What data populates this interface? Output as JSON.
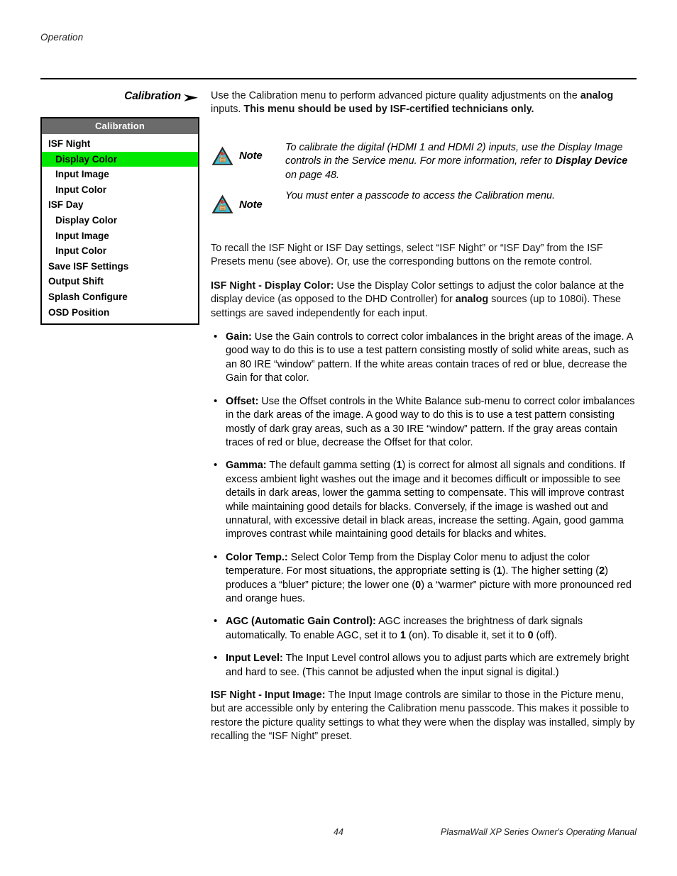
{
  "page": {
    "running_head": "Operation",
    "footer_page_number": "44",
    "footer_title": "PlasmaWall XP Series Owner's Operating Manual"
  },
  "margin_callout": {
    "label": "Calibration",
    "arrow_icon": "right-arrow-icon"
  },
  "osd_menu": {
    "title": "Calibration",
    "selected_item": "Display Color",
    "highlight_color": "#00e800",
    "title_bar_color": "#6b6b6b",
    "items": [
      {
        "label": "ISF Night",
        "level": 0,
        "selected": false
      },
      {
        "label": "Display Color",
        "level": 1,
        "selected": true
      },
      {
        "label": "Input Image",
        "level": 1,
        "selected": false
      },
      {
        "label": "Input Color",
        "level": 1,
        "selected": false
      },
      {
        "label": "ISF Day",
        "level": 0,
        "selected": false
      },
      {
        "label": "Display Color",
        "level": 1,
        "selected": false
      },
      {
        "label": "Input Image",
        "level": 1,
        "selected": false
      },
      {
        "label": "Input Color",
        "level": 1,
        "selected": false
      },
      {
        "label": "Save ISF Settings",
        "level": 0,
        "selected": false
      },
      {
        "label": "Output Shift",
        "level": 0,
        "selected": false
      },
      {
        "label": "Splash Configure",
        "level": 0,
        "selected": false
      },
      {
        "label": "OSD Position",
        "level": 0,
        "selected": false
      }
    ]
  },
  "intro": {
    "lead_plain_1": "Use the Calibration menu to perform advanced picture quality adjustments on the ",
    "lead_bold_1": "analog",
    "lead_plain_2": " inputs. ",
    "lead_bold_2": "This menu should be used by ISF-certified technicians only."
  },
  "notes": [
    {
      "label": "Note",
      "icon": "note-hand-triangle-icon",
      "text_1": "To calibrate the digital (HDMI 1 and HDMI 2) inputs, use the Display Image controls in the Service menu. For more information, refer to ",
      "text_bold": "Display Device",
      "text_2": " on page 48."
    },
    {
      "label": "Note",
      "icon": "note-hand-triangle-icon",
      "text_1": "You must enter a passcode to access the Calibration menu.",
      "text_bold": "",
      "text_2": ""
    }
  ],
  "paragraphs": {
    "recall": "To recall the ISF Night or ISF Day settings, select “ISF Night” or “ISF Day” from the ISF Presets menu (see above). Or, use the corresponding buttons on the remote control.",
    "display_color_heading": "ISF Night - Display Color:",
    "display_color_1": " Use the Display Color settings to adjust the color balance at the display device (as opposed to the DHD Controller) for ",
    "display_color_bold": "analog",
    "display_color_2": " sources (up to 1080i). These settings are saved independently for each input.",
    "input_image_heading": "ISF Night - Input Image:",
    "input_image_body": " The Input Image controls are similar to those in the Picture menu, but are accessible only by entering the Calibration menu passcode. This makes it possible to restore the picture quality settings to what they were when the display was installed, simply by recalling the “ISF Night” preset."
  },
  "bullets": [
    {
      "term": "Gain:",
      "text": " Use the Gain controls to correct color imbalances in the bright areas of the image. A good way to do this is to use a test pattern consisting mostly of solid white areas, such as an 80 IRE “window” pattern. If the white areas contain traces of red or blue, decrease the Gain for that color."
    },
    {
      "term": "Offset:",
      "text": " Use the Offset controls in the White Balance sub-menu to correct color imbalances in the dark areas of the image. A good way to do this is to use a test pattern consisting mostly of dark gray areas, such as a 30 IRE “window” pattern. If the gray areas contain traces of red or blue, decrease the Offset for that color."
    },
    {
      "term": "Gamma:",
      "text_a": " The default gamma setting (",
      "val_1": "1",
      "text_b": ") is correct for almost all signals and conditions. If excess ambient light washes out the image and it becomes difficult or impossible to see details in dark areas, lower the gamma setting to compensate. This will improve contrast while maintaining good details for blacks. Conversely, if the image is washed out and unnatural, with excessive detail in black areas, increase the setting. Again, good gamma improves contrast while maintaining good details for blacks and whites."
    },
    {
      "term": "Color Temp.:",
      "text_a": " Select Color Temp from the Display Color menu to adjust the color temperature. For most situations, the appropriate setting is (",
      "val_1": "1",
      "text_b": "). The higher setting (",
      "val_2": "2",
      "text_c": ") produces a “bluer” picture; the lower one (",
      "val_3": "0",
      "text_d": ") a “warmer” picture with more pronounced red and orange hues."
    },
    {
      "term": "AGC (Automatic Gain Control):",
      "text_a": " AGC increases the brightness of dark signals automatically. To enable AGC, set it to ",
      "val_1": "1",
      "text_b": " (on). To disable it, set it to ",
      "val_2": "0",
      "text_c": " (off)."
    },
    {
      "term": "Input Level:",
      "text": " The Input Level control allows you to adjust parts which are extremely bright and hard to see. (This cannot be adjusted when the input signal is digital.)"
    }
  ]
}
